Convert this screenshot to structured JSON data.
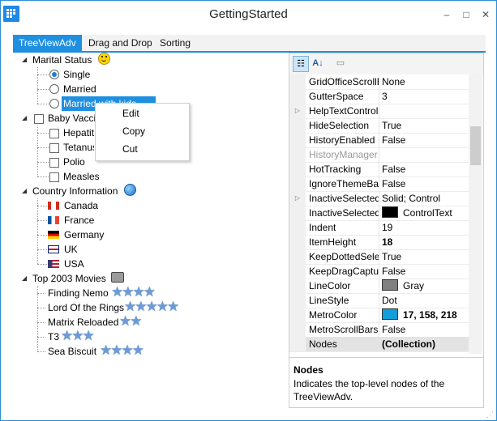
{
  "window": {
    "title": "GettingStarted",
    "minimize": "–",
    "maximize": "□",
    "close": "✕"
  },
  "tabs": [
    {
      "label": "TreeViewAdv"
    },
    {
      "label": "Drag and Drop"
    },
    {
      "label": "Sorting"
    }
  ],
  "tree": {
    "marital": {
      "label": "Marital Status",
      "icon": "smiley-icon",
      "children": [
        "Single",
        "Married",
        "Married with kids"
      ]
    },
    "baby": {
      "label": "Baby Vaccines",
      "children": [
        "Hepatitis",
        "Tetanus",
        "Polio",
        "Measles"
      ]
    },
    "country": {
      "label": "Country Information",
      "icon": "globe-icon",
      "children": [
        "Canada",
        "France",
        "Germany",
        "UK",
        "USA"
      ]
    },
    "movies": {
      "label": "Top 2003 Movies",
      "icon": "film-camera-icon",
      "children": [
        {
          "name": "Finding Nemo",
          "stars": 4
        },
        {
          "name": "Lord Of the Rings",
          "stars": 5
        },
        {
          "name": "Matrix Reloaded",
          "stars": 2
        },
        {
          "name": "T3",
          "stars": 3
        },
        {
          "name": "Sea Biscuit",
          "stars": 4
        }
      ]
    }
  },
  "context_menu": {
    "items": [
      "Edit",
      "Copy",
      "Cut"
    ]
  },
  "property_grid": {
    "rows": [
      {
        "name": "GridOfficeScrollB",
        "value": "None",
        "expandable": false
      },
      {
        "name": "GutterSpace",
        "value": "3",
        "expandable": false
      },
      {
        "name": "HelpTextControl",
        "value": "",
        "expandable": true
      },
      {
        "name": "HideSelection",
        "value": "True",
        "expandable": false
      },
      {
        "name": "HistoryEnabled",
        "value": "False",
        "expandable": false
      },
      {
        "name": "HistoryManager",
        "value": "",
        "expandable": false,
        "disabled": true
      },
      {
        "name": "HotTracking",
        "value": "False",
        "expandable": false
      },
      {
        "name": "IgnoreThemeBac",
        "value": "False",
        "expandable": false
      },
      {
        "name": "InactiveSelectedN",
        "value": "Solid; Control",
        "expandable": true
      },
      {
        "name": "InactiveSelectedN",
        "value": "ControlText",
        "expandable": false,
        "color": "#000000"
      },
      {
        "name": "Indent",
        "value": "19",
        "expandable": false
      },
      {
        "name": "ItemHeight",
        "value": "18",
        "expandable": false,
        "bold": true
      },
      {
        "name": "KeepDottedSelec",
        "value": "True",
        "expandable": false
      },
      {
        "name": "KeepDragCaptur",
        "value": "False",
        "expandable": false
      },
      {
        "name": "LineColor",
        "value": "Gray",
        "expandable": false,
        "color": "#808080"
      },
      {
        "name": "LineStyle",
        "value": "Dot",
        "expandable": false
      },
      {
        "name": "MetroColor",
        "value": "17, 158, 218",
        "expandable": false,
        "bold": true,
        "color": "#119eda"
      },
      {
        "name": "MetroScrollBars",
        "value": "False",
        "expandable": false
      },
      {
        "name": "Nodes",
        "value": "(Collection)",
        "expandable": false,
        "bold": true,
        "selected": true
      }
    ],
    "description_title": "Nodes",
    "description_text": "Indicates the top-level nodes of the TreeViewAdv."
  }
}
